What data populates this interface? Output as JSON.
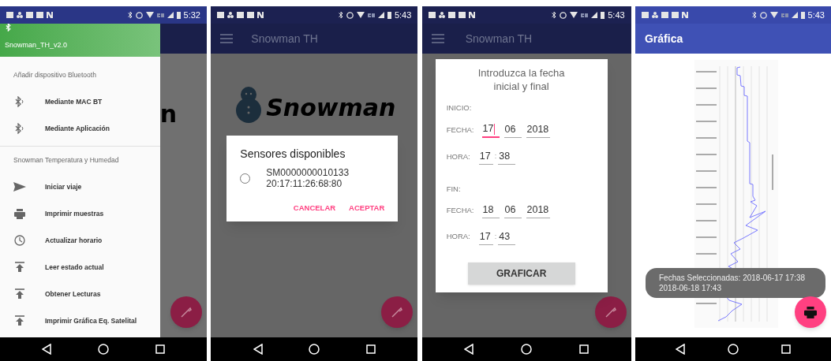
{
  "screens": [
    {
      "kind": "drawer",
      "time": "5:32",
      "background": {
        "logo_fragment": "n"
      },
      "drawer": {
        "title": "Snowman_TH_v2.0",
        "sections": [
          {
            "title": "Añadir dispositivo Bluetooth",
            "items": [
              {
                "label": "Mediante MAC BT",
                "kind": "bluetooth"
              },
              {
                "label": "Mediante Aplicación",
                "kind": "bluetooth"
              }
            ]
          },
          {
            "title": "Snowman Temperatura y Humedad",
            "items": [
              {
                "label": "Iniciar viaje",
                "kind": "send"
              },
              {
                "label": "Imprimir muestras",
                "kind": "print"
              },
              {
                "label": "Actualizar horario",
                "kind": "clock"
              },
              {
                "label": "Leer estado actual",
                "kind": "upload"
              },
              {
                "label": "Obtener Lecturas",
                "kind": "upload"
              },
              {
                "label": "Imprimir Gráfica Eq. Satelital",
                "kind": "upload"
              }
            ]
          }
        ]
      }
    },
    {
      "kind": "sensors",
      "time": "5:43",
      "title": "Snowman TH",
      "logo_text": "Snowman",
      "dialog": {
        "title": "Sensores disponibles",
        "options": [
          {
            "name": "SM0000000010133",
            "address": "20:17:11:26:68:80",
            "selected": false
          }
        ],
        "buttons": [
          "CANCELAR",
          "ACEPTAR"
        ]
      }
    },
    {
      "kind": "dates",
      "time": "5:43",
      "title": "Snowman TH",
      "dialog": {
        "heading": "Introduzca la fecha inicial y final",
        "groups": [
          {
            "title": "INICIO:",
            "date_label": "FECHA:",
            "date": [
              {
                "value": "17",
                "focused": true
              },
              {
                "value": "06",
                "focused": false
              },
              {
                "value": "2018",
                "focused": false
              }
            ],
            "time_label": "HORA:",
            "time": [
              {
                "value": "17",
                "focused": false
              },
              {
                "value": "38",
                "focused": false
              }
            ],
            "separator": ":"
          },
          {
            "title": "FIN:",
            "date_label": "FECHA:",
            "date": [
              {
                "value": "18",
                "focused": false
              },
              {
                "value": "06",
                "focused": false
              },
              {
                "value": "2018",
                "focused": false
              }
            ],
            "time_label": "HORA:",
            "time": [
              {
                "value": "17",
                "focused": false
              },
              {
                "value": "43",
                "focused": false
              }
            ],
            "separator": ":"
          }
        ],
        "button": "GRAFICAR"
      }
    },
    {
      "kind": "graph",
      "time": "5:43",
      "title": "Gráfica",
      "toast": "Fechas Seleccionadas: 2018-06-17 17:38 2018-06-18 17:43"
    }
  ]
}
